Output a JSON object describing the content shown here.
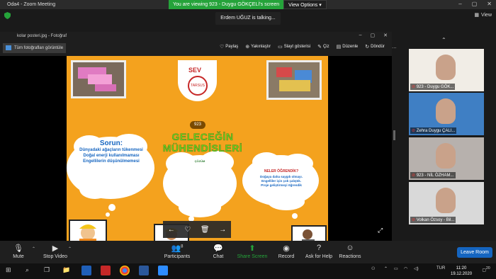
{
  "app": {
    "title": "Oda4 - Zoom Meeting"
  },
  "share": {
    "viewing": "You are viewing 923 - Duygu GÖKÇELİ's screen",
    "view_options": "View Options"
  },
  "talking": "Erdem UĞUZ is talking...",
  "view_button": "View",
  "photos": {
    "window_title": "kolar posteri.jpg - Fotoğraf",
    "all_photos": "Tüm fotoğrafları görüntüle",
    "toolbar": [
      {
        "icon": "♡",
        "label": "Paylaş"
      },
      {
        "icon": "⊕",
        "label": "Yakınlaştır"
      },
      {
        "icon": "▭",
        "label": "Slayt gösterisi"
      },
      {
        "icon": "✎",
        "label": "Çiz"
      },
      {
        "icon": "▤",
        "label": "Düzenle"
      },
      {
        "icon": "↻",
        "label": "Döndür"
      },
      {
        "icon": "…",
        "label": ""
      }
    ]
  },
  "poster": {
    "logo_text": "SEV",
    "logo_sub": "TARSUS",
    "badge": "923",
    "headline": "GELECEĞİN MÜHENDİSLERİ",
    "problem_title": "Sorun:",
    "problem_lines": [
      "Dünyadaki ağaçların tükenmesi",
      "Doğal enerji kullanılmaması",
      "Engellilerin düşünülmemesi"
    ],
    "solution_title": "ÇÖZÜM",
    "learned_title": "NELER ÖĞRENDİK?",
    "learned_lines": [
      "Doğaya daha saygılı olmayı.",
      "Engelliler için çok çalıştık.",
      "Proje geliştirmeyi öğrendik"
    ]
  },
  "participants": [
    {
      "name": "923 - Duygu GÖK...",
      "bg": "#f1ede6"
    },
    {
      "name": "Zehra Duygu ÇALI...",
      "bg": "#3f7fc4"
    },
    {
      "name": "923 - NİL ÖZHAM...",
      "bg": "#b7b1ad"
    },
    {
      "name": "Volkan Özsoy - Bil...",
      "bg": "#d9d9d9"
    }
  ],
  "toolbar": {
    "mute": "Mute",
    "stop_video": "Stop Video",
    "participants": "Participants",
    "participants_count": "8",
    "chat": "Chat",
    "share_screen": "Share Screen",
    "record": "Record",
    "ask_help": "Ask for Help",
    "reactions": "Reactions",
    "leave": "Leave Room"
  },
  "taskbar": {
    "lang": "TUR",
    "time": "11:20",
    "date": "19.12.2020",
    "notif": "20"
  }
}
